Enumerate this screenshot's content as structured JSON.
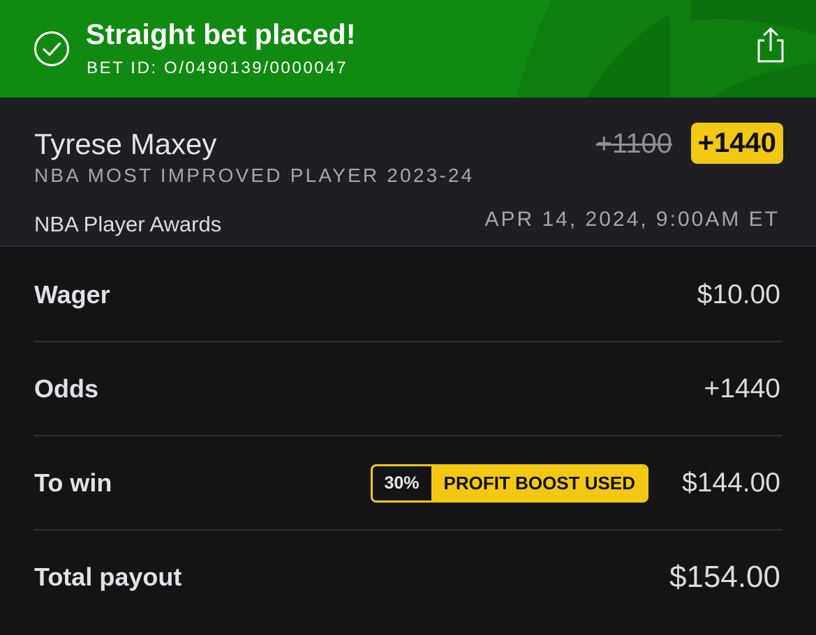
{
  "banner": {
    "title": "Straight bet placed!",
    "bet_id": "BET ID: O/0490139/0000047",
    "color": "#118a11",
    "status_icon": "check-circle-icon",
    "share_icon": "share-icon"
  },
  "selection": {
    "player": "Tyrese Maxey",
    "market": "NBA MOST IMPROVED PLAYER 2023-24",
    "event": "NBA Player Awards",
    "event_time": "APR 14, 2024, 9:00AM ET",
    "original_odds": "+1100",
    "boosted_odds": "+1440",
    "highlight_color": "#f3c812"
  },
  "details": {
    "wager_label": "Wager",
    "wager_value": "$10.00",
    "odds_label": "Odds",
    "odds_value": "+1440",
    "to_win_label": "To win",
    "boost_percent": "30%",
    "boost_text": "PROFIT BOOST USED",
    "to_win_value": "$144.00",
    "total_label": "Total payout",
    "total_value": "$154.00"
  }
}
